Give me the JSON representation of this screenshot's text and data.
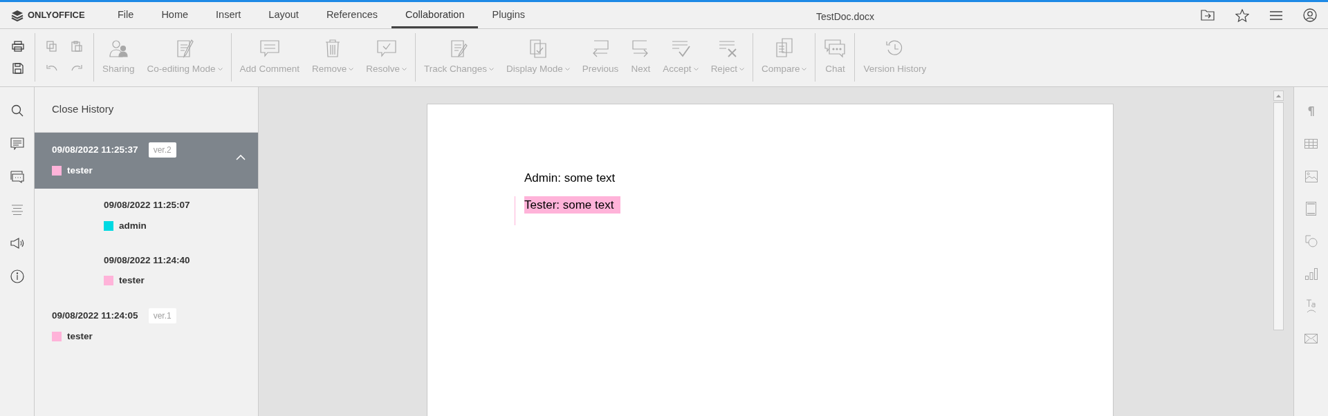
{
  "header": {
    "logo": "ONLYOFFICE",
    "title": "TestDoc.docx"
  },
  "menu_tabs": [
    {
      "label": "File",
      "selected": false
    },
    {
      "label": "Home",
      "selected": false
    },
    {
      "label": "Insert",
      "selected": false
    },
    {
      "label": "Layout",
      "selected": false
    },
    {
      "label": "References",
      "selected": false
    },
    {
      "label": "Collaboration",
      "selected": true
    },
    {
      "label": "Plugins",
      "selected": false
    }
  ],
  "quick_buttons": [
    {
      "disabled": false
    },
    {
      "disabled": false
    },
    {
      "disabled": true
    },
    {
      "disabled": true
    },
    {
      "disabled": true
    },
    {
      "disabled": true
    }
  ],
  "toolbar_groups": [
    {
      "buttons": [
        {
          "label": "Sharing",
          "dropdown": false,
          "disabled": true
        },
        {
          "label": "Co-editing Mode",
          "dropdown": true,
          "disabled": true
        }
      ]
    },
    {
      "buttons": [
        {
          "label": "Add Comment",
          "dropdown": false,
          "disabled": true
        },
        {
          "label": "Remove",
          "dropdown": true,
          "disabled": true
        },
        {
          "label": "Resolve",
          "dropdown": true,
          "disabled": true
        }
      ]
    },
    {
      "buttons": [
        {
          "label": "Track Changes",
          "dropdown": true,
          "disabled": true
        },
        {
          "label": "Display Mode",
          "dropdown": true,
          "disabled": true
        },
        {
          "label": "Previous",
          "dropdown": false,
          "disabled": true
        },
        {
          "label": "Next",
          "dropdown": false,
          "disabled": true
        },
        {
          "label": "Accept",
          "dropdown": true,
          "disabled": true
        },
        {
          "label": "Reject",
          "dropdown": true,
          "disabled": true
        }
      ]
    },
    {
      "buttons": [
        {
          "label": "Compare",
          "dropdown": true,
          "disabled": true
        }
      ]
    },
    {
      "buttons": [
        {
          "label": "Chat",
          "dropdown": false,
          "disabled": true
        }
      ]
    },
    {
      "buttons": [
        {
          "label": "Version History",
          "dropdown": false,
          "disabled": true
        }
      ]
    }
  ],
  "history": {
    "close_label": "Close History",
    "versions": [
      {
        "date": "09/08/2022 11:25:37",
        "version": "ver.2",
        "user": "tester",
        "color": "#ffb3d9",
        "selected": true,
        "expanded": true,
        "children": [
          {
            "date": "09/08/2022 11:25:07",
            "user": "admin",
            "color": "#00d9e2",
            "selected": false
          },
          {
            "date": "09/08/2022 11:24:40",
            "user": "tester",
            "color": "#ffb3d9",
            "selected": false
          }
        ]
      },
      {
        "date": "09/08/2022 11:24:05",
        "version": "ver.1",
        "user": "tester",
        "color": "#ffb3d9",
        "selected": false
      }
    ]
  },
  "document": {
    "paragraphs": [
      {
        "text": "Admin: some text",
        "changed": false
      },
      {
        "text": "Tester: some text",
        "changed": true,
        "color": "#ffb3d9"
      }
    ]
  }
}
